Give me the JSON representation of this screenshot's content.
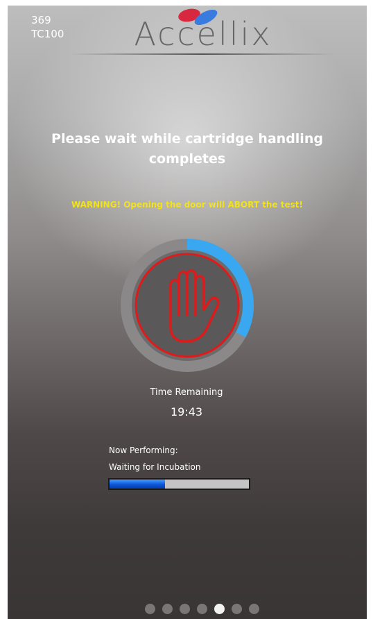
{
  "device": {
    "number": "369",
    "model": "TC100"
  },
  "logo": {
    "text": "Accellix",
    "colors": {
      "mark_red": "#d8283f",
      "mark_blue": "#3a7be0"
    }
  },
  "status": {
    "title": "Please wait while cartridge handling completes",
    "warning": "WARNING! Opening the door will ABORT the test!",
    "warning_color": "#f2e21a",
    "icon": "stop-hand-icon"
  },
  "timer": {
    "label": "Time Remaining",
    "value": "19:43",
    "ring_progress": 0.33,
    "ring_color": "#3aa8f0"
  },
  "activity": {
    "label": "Now Performing:",
    "value": "Waiting for Incubation",
    "progress": 0.4
  },
  "pager": {
    "count": 7,
    "active_index": 4
  }
}
